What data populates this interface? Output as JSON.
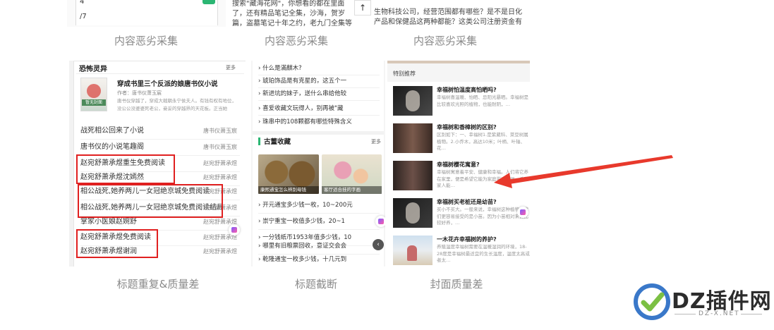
{
  "top_row": {
    "left": {
      "input_lines": [
        "4",
        "/7"
      ],
      "caption": "内容恶劣采集"
    },
    "middle": {
      "text": "搜索\"藏海花网\"，你想看的都在里面了，还有精品笔记全集，沙海，贺岁篇，盗墓笔记十年之约，老九门全集等南派三叔所有作品。",
      "top_icon": "↑",
      "caption": "内容恶劣采集"
    },
    "right": {
      "text": "生物科技公司，经营范围都有哪些？是不是日化产品和保健品这两种都能？这类公司注册资金有限制吗？",
      "caption": "内容恶劣采集"
    }
  },
  "panel1": {
    "title": "恐怖灵异",
    "more": "更多",
    "feature": {
      "thumb_text": "暂无封面",
      "title": "穿成书里三个反派的娘唐书仪小说",
      "author": "作者：唐书仪萧玉宸",
      "desc": "唐书仪穿越了，穿成大戟朝永宁侯夫人。有钱有权有地位，没公公没婆婆死老公，妾妥的穿越界的天花板。正当她"
    },
    "rows": [
      {
        "title": "战死相公回来了小说",
        "author": "唐书仪萧玉宸"
      },
      {
        "title": "唐书仪的小说笔趣阁",
        "author": "唐书仪萧玉宸"
      },
      {
        "title": "赵宛舒萧承煜重生免费阅读",
        "author": "赵宛舒萧承煜"
      },
      {
        "title": "赵宛舒萧承煜沈嫣然",
        "author": "赵宛舒萧承煜"
      },
      {
        "title": "相公战死,她养两儿一女冠绝京城免费阅读",
        "author": "赵宛舒萧承煜"
      },
      {
        "title": "相公战死,她养两儿一女冠绝京城免费阅读结局",
        "author": "赵宛舒萧承煜"
      },
      {
        "title": "掌家小医娘赵婉舒",
        "author": "赵宛舒萧承煜"
      },
      {
        "title": "赵宛舒萧承煜免费阅读",
        "author": "赵宛舒萧承煜"
      },
      {
        "title": "赵宛舒萧承煜谢润",
        "author": "赵宛舒萧承煜"
      }
    ],
    "caption": "标题重复&质量差"
  },
  "panel2": {
    "top_list": [
      "什么是滿麒木?",
      "琥珀饰品是有克星的，这五个一",
      "新进坑的妹子，送什么串给他较",
      "喜爱收藏文玩得人，别再被\"藏",
      "珠串中的108颗都有哪些特殊含义"
    ],
    "section_title": "古董收藏",
    "more": "更多",
    "img_captions": [
      "康熙通宝怎么辨别母钱",
      "客厅适合挂的字画"
    ],
    "bottom_list": [
      "开元通宝多少钱一枚，10~200元",
      "崇宁重宝一枚值多少钱，20~1",
      "一分钱纸币1953年值多少钱，10",
      "哪里有旧粮票回收，意证交会会",
      "乾隆通宝一枚多少钱，十几元到"
    ],
    "caption": "标题截断"
  },
  "panel3": {
    "section_title": "特别推荐",
    "items": [
      {
        "title": "幸福树怕温度高怕晒吗?",
        "desc": "幸福树喜温暖、怕晒、忌阳光暴晒。幸福树是比较喜欢光照的植物，也能耐阴，…"
      },
      {
        "title": "幸福树和香樟树的区别?",
        "desc": "区别如下：一、幸福树1.是紫葳科、菜豆树属植物。2.小乔木，高达10米；叶柄、叶轴、花…"
      },
      {
        "title": "幸福树樱花寓意?",
        "desc": "幸福树寓意着平安、健康和幸福。人们将它养在家里，便是希望它能为家庭带来幸福，希望家人能…"
      },
      {
        "title": "幸福树买老桩还是幼苗?",
        "desc": "买小不买大。一般来说，幸福树这种植物，我们更容易接受的是小苗。因为小苗相对来说比较好养，…"
      },
      {
        "title": "一木花卉幸福树的养护?",
        "desc": "养殖温度幸福树需要在温暖湿润的环境，18-28度是幸福树最适宜的生长温度，温度太高或者太…"
      }
    ],
    "caption": "封面质量差"
  },
  "watermark": {
    "logo_text": "DZ插件网",
    "sub_text": "DZ-X.NET"
  },
  "colors": {
    "highlight_red": "#e02020",
    "arrow_red": "#e8392c",
    "green": "#2bb673",
    "logo_blue": "#3a78c9"
  }
}
